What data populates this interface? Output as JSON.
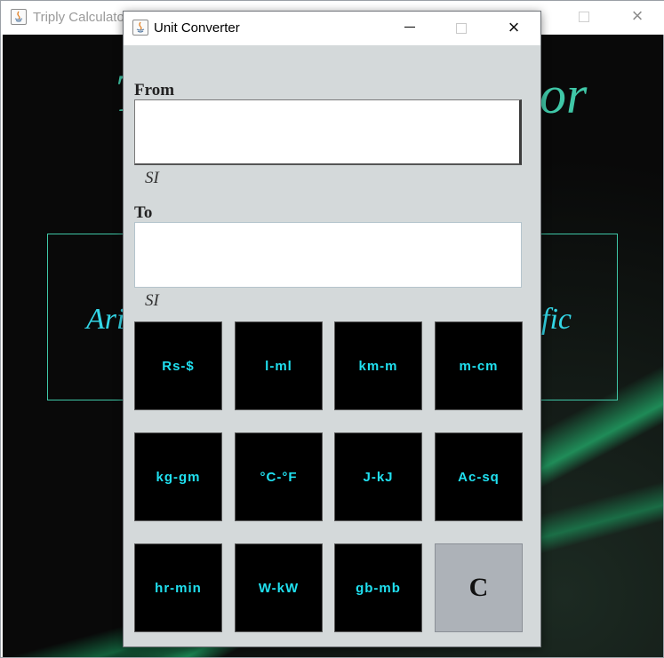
{
  "background_window": {
    "title": "Triply Calculator",
    "heading_left": "T",
    "heading_right": "or",
    "box_left_text": "Ari",
    "box_right_text": "fic"
  },
  "dialog": {
    "title": "Unit Converter",
    "from_label": "From",
    "from_value": "",
    "from_unit": "SI",
    "to_label": "To",
    "to_value": "",
    "to_unit": "SI",
    "buttons": [
      "Rs-$",
      "l-ml",
      "km-m",
      "m-cm",
      "kg-gm",
      "°C-°F",
      "J-kJ",
      "Ac-sq",
      "hr-min",
      "W-kW",
      "gb-mb",
      "C"
    ]
  },
  "colors": {
    "accent_text": "#20e0f0",
    "heading": "#3fc7a7",
    "dialog_bg": "#d4d9da",
    "button_bg": "#000000",
    "clear_button_bg": "#adb2b8"
  }
}
